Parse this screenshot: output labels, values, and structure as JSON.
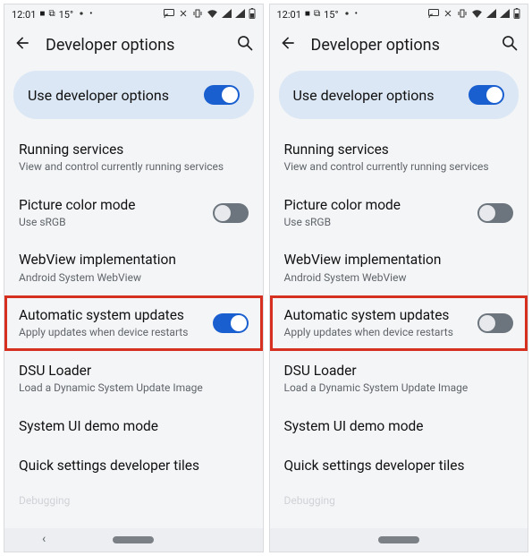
{
  "screens": [
    {
      "statusbar": {
        "time": "12:01",
        "temp": "15°",
        "icons_left": [
          "■",
          "⧉"
        ],
        "dot": "•"
      },
      "header": {
        "title": "Developer options"
      },
      "hero": {
        "title": "Use developer options",
        "toggle_on": true
      },
      "rows": [
        {
          "title": "Running services",
          "sub": "View and control currently running services",
          "toggle": null
        },
        {
          "title": "Picture color mode",
          "sub": "Use sRGB",
          "toggle": false
        },
        {
          "title": "WebView implementation",
          "sub": "Android System WebView",
          "toggle": null
        },
        {
          "title": "Automatic system updates",
          "sub": "Apply updates when device restarts",
          "toggle": true,
          "highlight": true
        },
        {
          "title": "DSU Loader",
          "sub": "Load a Dynamic System Update Image",
          "toggle": null
        },
        {
          "title": "System UI demo mode",
          "sub": "",
          "toggle": null
        },
        {
          "title": "Quick settings developer tiles",
          "sub": "",
          "toggle": null
        }
      ],
      "section_label": "Debugging"
    },
    {
      "statusbar": {
        "time": "12:01",
        "temp": "15°",
        "icons_left": [
          "■",
          "⧉"
        ],
        "dot": "•"
      },
      "header": {
        "title": "Developer options"
      },
      "hero": {
        "title": "Use developer options",
        "toggle_on": true
      },
      "rows": [
        {
          "title": "Running services",
          "sub": "View and control currently running services",
          "toggle": null
        },
        {
          "title": "Picture color mode",
          "sub": "Use sRGB",
          "toggle": false
        },
        {
          "title": "WebView implementation",
          "sub": "Android System WebView",
          "toggle": null
        },
        {
          "title": "Automatic system updates",
          "sub": "Apply updates when device restarts",
          "toggle": false,
          "highlight": true
        },
        {
          "title": "DSU Loader",
          "sub": "Load a Dynamic System Update Image",
          "toggle": null
        },
        {
          "title": "System UI demo mode",
          "sub": "",
          "toggle": null
        },
        {
          "title": "Quick settings developer tiles",
          "sub": "",
          "toggle": null
        }
      ],
      "section_label": "Debugging"
    }
  ]
}
